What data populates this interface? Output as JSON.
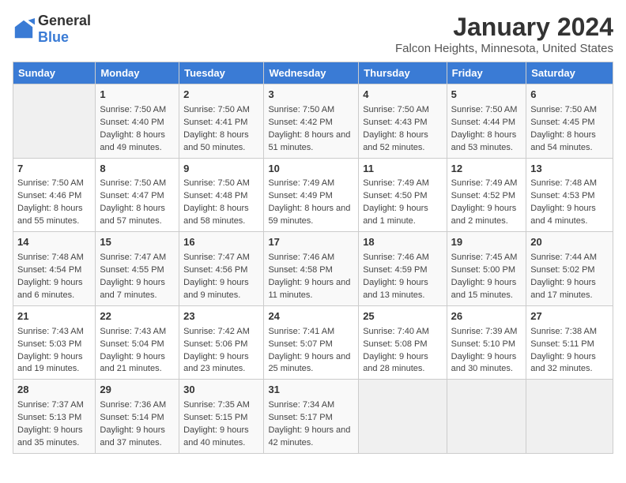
{
  "logo": {
    "general": "General",
    "blue": "Blue"
  },
  "title": "January 2024",
  "subtitle": "Falcon Heights, Minnesota, United States",
  "days_of_week": [
    "Sunday",
    "Monday",
    "Tuesday",
    "Wednesday",
    "Thursday",
    "Friday",
    "Saturday"
  ],
  "weeks": [
    [
      {
        "num": "",
        "sunrise": "",
        "sunset": "",
        "daylight": ""
      },
      {
        "num": "1",
        "sunrise": "Sunrise: 7:50 AM",
        "sunset": "Sunset: 4:40 PM",
        "daylight": "Daylight: 8 hours and 49 minutes."
      },
      {
        "num": "2",
        "sunrise": "Sunrise: 7:50 AM",
        "sunset": "Sunset: 4:41 PM",
        "daylight": "Daylight: 8 hours and 50 minutes."
      },
      {
        "num": "3",
        "sunrise": "Sunrise: 7:50 AM",
        "sunset": "Sunset: 4:42 PM",
        "daylight": "Daylight: 8 hours and 51 minutes."
      },
      {
        "num": "4",
        "sunrise": "Sunrise: 7:50 AM",
        "sunset": "Sunset: 4:43 PM",
        "daylight": "Daylight: 8 hours and 52 minutes."
      },
      {
        "num": "5",
        "sunrise": "Sunrise: 7:50 AM",
        "sunset": "Sunset: 4:44 PM",
        "daylight": "Daylight: 8 hours and 53 minutes."
      },
      {
        "num": "6",
        "sunrise": "Sunrise: 7:50 AM",
        "sunset": "Sunset: 4:45 PM",
        "daylight": "Daylight: 8 hours and 54 minutes."
      }
    ],
    [
      {
        "num": "7",
        "sunrise": "Sunrise: 7:50 AM",
        "sunset": "Sunset: 4:46 PM",
        "daylight": "Daylight: 8 hours and 55 minutes."
      },
      {
        "num": "8",
        "sunrise": "Sunrise: 7:50 AM",
        "sunset": "Sunset: 4:47 PM",
        "daylight": "Daylight: 8 hours and 57 minutes."
      },
      {
        "num": "9",
        "sunrise": "Sunrise: 7:50 AM",
        "sunset": "Sunset: 4:48 PM",
        "daylight": "Daylight: 8 hours and 58 minutes."
      },
      {
        "num": "10",
        "sunrise": "Sunrise: 7:49 AM",
        "sunset": "Sunset: 4:49 PM",
        "daylight": "Daylight: 8 hours and 59 minutes."
      },
      {
        "num": "11",
        "sunrise": "Sunrise: 7:49 AM",
        "sunset": "Sunset: 4:50 PM",
        "daylight": "Daylight: 9 hours and 1 minute."
      },
      {
        "num": "12",
        "sunrise": "Sunrise: 7:49 AM",
        "sunset": "Sunset: 4:52 PM",
        "daylight": "Daylight: 9 hours and 2 minutes."
      },
      {
        "num": "13",
        "sunrise": "Sunrise: 7:48 AM",
        "sunset": "Sunset: 4:53 PM",
        "daylight": "Daylight: 9 hours and 4 minutes."
      }
    ],
    [
      {
        "num": "14",
        "sunrise": "Sunrise: 7:48 AM",
        "sunset": "Sunset: 4:54 PM",
        "daylight": "Daylight: 9 hours and 6 minutes."
      },
      {
        "num": "15",
        "sunrise": "Sunrise: 7:47 AM",
        "sunset": "Sunset: 4:55 PM",
        "daylight": "Daylight: 9 hours and 7 minutes."
      },
      {
        "num": "16",
        "sunrise": "Sunrise: 7:47 AM",
        "sunset": "Sunset: 4:56 PM",
        "daylight": "Daylight: 9 hours and 9 minutes."
      },
      {
        "num": "17",
        "sunrise": "Sunrise: 7:46 AM",
        "sunset": "Sunset: 4:58 PM",
        "daylight": "Daylight: 9 hours and 11 minutes."
      },
      {
        "num": "18",
        "sunrise": "Sunrise: 7:46 AM",
        "sunset": "Sunset: 4:59 PM",
        "daylight": "Daylight: 9 hours and 13 minutes."
      },
      {
        "num": "19",
        "sunrise": "Sunrise: 7:45 AM",
        "sunset": "Sunset: 5:00 PM",
        "daylight": "Daylight: 9 hours and 15 minutes."
      },
      {
        "num": "20",
        "sunrise": "Sunrise: 7:44 AM",
        "sunset": "Sunset: 5:02 PM",
        "daylight": "Daylight: 9 hours and 17 minutes."
      }
    ],
    [
      {
        "num": "21",
        "sunrise": "Sunrise: 7:43 AM",
        "sunset": "Sunset: 5:03 PM",
        "daylight": "Daylight: 9 hours and 19 minutes."
      },
      {
        "num": "22",
        "sunrise": "Sunrise: 7:43 AM",
        "sunset": "Sunset: 5:04 PM",
        "daylight": "Daylight: 9 hours and 21 minutes."
      },
      {
        "num": "23",
        "sunrise": "Sunrise: 7:42 AM",
        "sunset": "Sunset: 5:06 PM",
        "daylight": "Daylight: 9 hours and 23 minutes."
      },
      {
        "num": "24",
        "sunrise": "Sunrise: 7:41 AM",
        "sunset": "Sunset: 5:07 PM",
        "daylight": "Daylight: 9 hours and 25 minutes."
      },
      {
        "num": "25",
        "sunrise": "Sunrise: 7:40 AM",
        "sunset": "Sunset: 5:08 PM",
        "daylight": "Daylight: 9 hours and 28 minutes."
      },
      {
        "num": "26",
        "sunrise": "Sunrise: 7:39 AM",
        "sunset": "Sunset: 5:10 PM",
        "daylight": "Daylight: 9 hours and 30 minutes."
      },
      {
        "num": "27",
        "sunrise": "Sunrise: 7:38 AM",
        "sunset": "Sunset: 5:11 PM",
        "daylight": "Daylight: 9 hours and 32 minutes."
      }
    ],
    [
      {
        "num": "28",
        "sunrise": "Sunrise: 7:37 AM",
        "sunset": "Sunset: 5:13 PM",
        "daylight": "Daylight: 9 hours and 35 minutes."
      },
      {
        "num": "29",
        "sunrise": "Sunrise: 7:36 AM",
        "sunset": "Sunset: 5:14 PM",
        "daylight": "Daylight: 9 hours and 37 minutes."
      },
      {
        "num": "30",
        "sunrise": "Sunrise: 7:35 AM",
        "sunset": "Sunset: 5:15 PM",
        "daylight": "Daylight: 9 hours and 40 minutes."
      },
      {
        "num": "31",
        "sunrise": "Sunrise: 7:34 AM",
        "sunset": "Sunset: 5:17 PM",
        "daylight": "Daylight: 9 hours and 42 minutes."
      },
      {
        "num": "",
        "sunrise": "",
        "sunset": "",
        "daylight": ""
      },
      {
        "num": "",
        "sunrise": "",
        "sunset": "",
        "daylight": ""
      },
      {
        "num": "",
        "sunrise": "",
        "sunset": "",
        "daylight": ""
      }
    ]
  ]
}
